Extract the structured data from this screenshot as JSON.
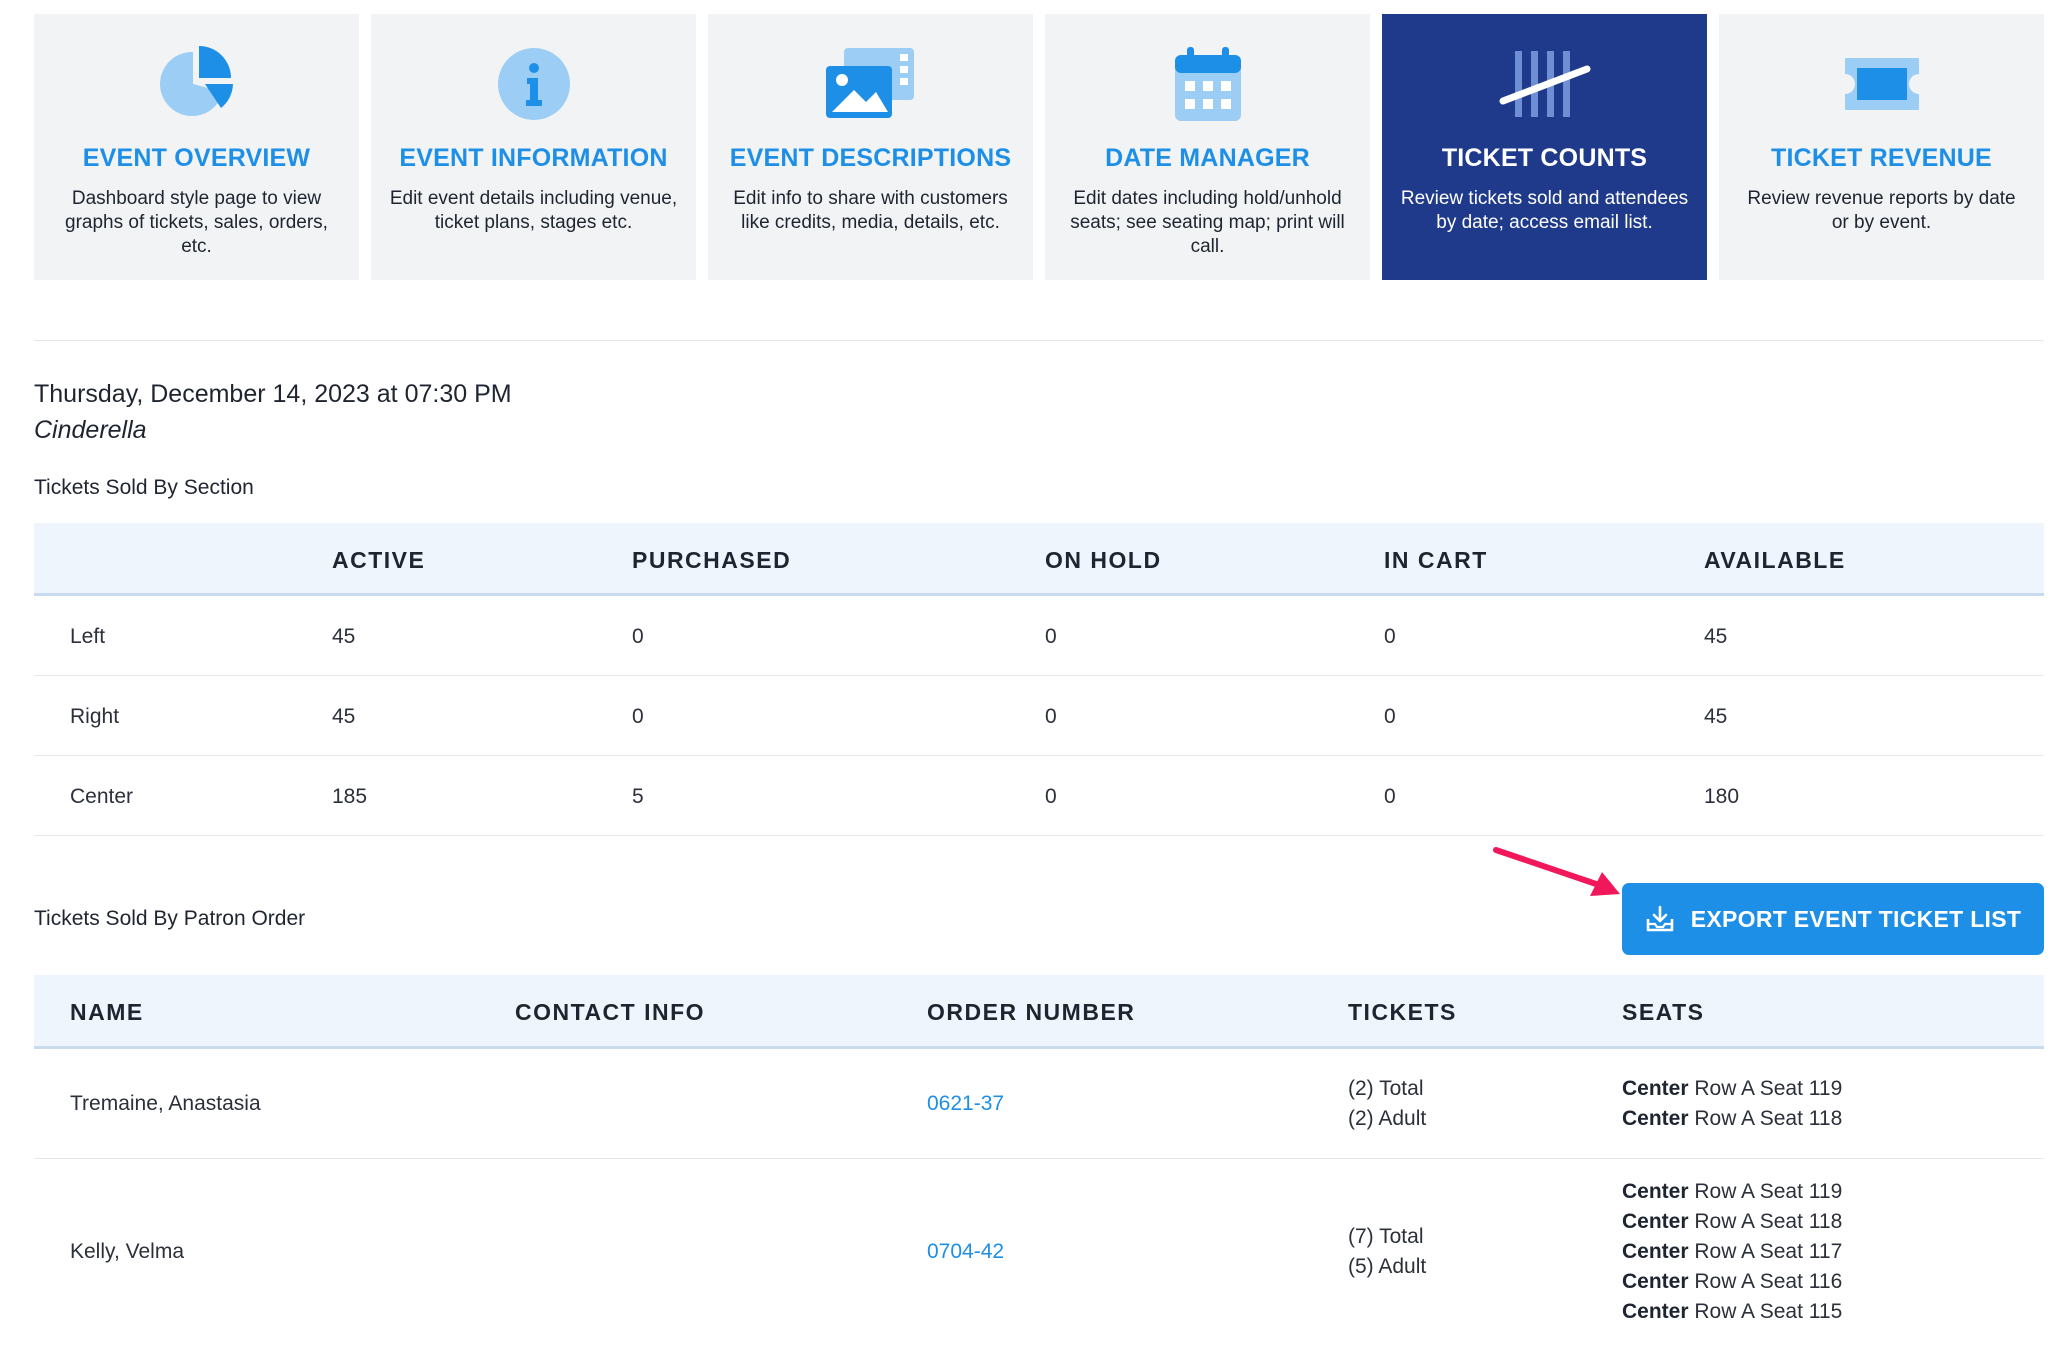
{
  "nav_cards": [
    {
      "title": "EVENT OVERVIEW",
      "desc": "Dashboard style page to view graphs of tickets, sales, orders, etc.",
      "icon": "pie-chart-icon"
    },
    {
      "title": "EVENT INFORMATION",
      "desc": "Edit event details including venue, ticket plans, stages etc.",
      "icon": "info-icon"
    },
    {
      "title": "EVENT DESCRIPTIONS",
      "desc": "Edit info to share with customers like credits, media, details, etc.",
      "icon": "media-icon"
    },
    {
      "title": "DATE MANAGER",
      "desc": "Edit dates including hold/unhold seats; see seating map; print will call.",
      "icon": "calendar-icon"
    },
    {
      "title": "TICKET COUNTS",
      "desc": "Review tickets sold and attendees by date; access email list.",
      "icon": "tally-icon",
      "active": true
    },
    {
      "title": "TICKET REVENUE",
      "desc": "Review revenue reports by date or by event.",
      "icon": "ticket-icon"
    }
  ],
  "event": {
    "datetime": "Thursday, December 14, 2023 at 07:30 PM",
    "title": "Cinderella"
  },
  "section_table": {
    "label": "Tickets Sold By Section",
    "headers": [
      "",
      "ACTIVE",
      "PURCHASED",
      "ON HOLD",
      "IN CART",
      "AVAILABLE"
    ],
    "rows": [
      [
        "Left",
        "45",
        "0",
        "0",
        "0",
        "45"
      ],
      [
        "Right",
        "45",
        "0",
        "0",
        "0",
        "45"
      ],
      [
        "Center",
        "185",
        "5",
        "0",
        "0",
        "180"
      ]
    ]
  },
  "order_table": {
    "label": "Tickets Sold By Patron Order",
    "export_label": "EXPORT EVENT TICKET LIST",
    "headers": [
      "NAME",
      "CONTACT INFO",
      "ORDER NUMBER",
      "TICKETS",
      "SEATS"
    ],
    "rows": [
      {
        "name": "Tremaine, Anastasia",
        "contact": "",
        "order": "0621-37",
        "tickets": [
          "(2) Total",
          "(2) Adult"
        ],
        "seats": [
          {
            "section": "Center",
            "detail": "Row A Seat 119"
          },
          {
            "section": "Center",
            "detail": "Row A Seat 118"
          }
        ]
      },
      {
        "name": "Kelly, Velma",
        "contact": "",
        "order": "0704-42",
        "tickets": [
          "(7) Total",
          "(5) Adult"
        ],
        "seats": [
          {
            "section": "Center",
            "detail": "Row A Seat 119"
          },
          {
            "section": "Center",
            "detail": "Row A Seat 118"
          },
          {
            "section": "Center",
            "detail": "Row A Seat 117"
          },
          {
            "section": "Center",
            "detail": "Row A Seat 116"
          },
          {
            "section": "Center",
            "detail": "Row A Seat 115"
          }
        ]
      }
    ]
  },
  "colors": {
    "accent": "#1e8fe6",
    "active_card": "#1f3a8a",
    "card_bg": "#f1f3f5",
    "header_bg": "#eef5fd",
    "annotation_arrow": "#f0185a"
  }
}
